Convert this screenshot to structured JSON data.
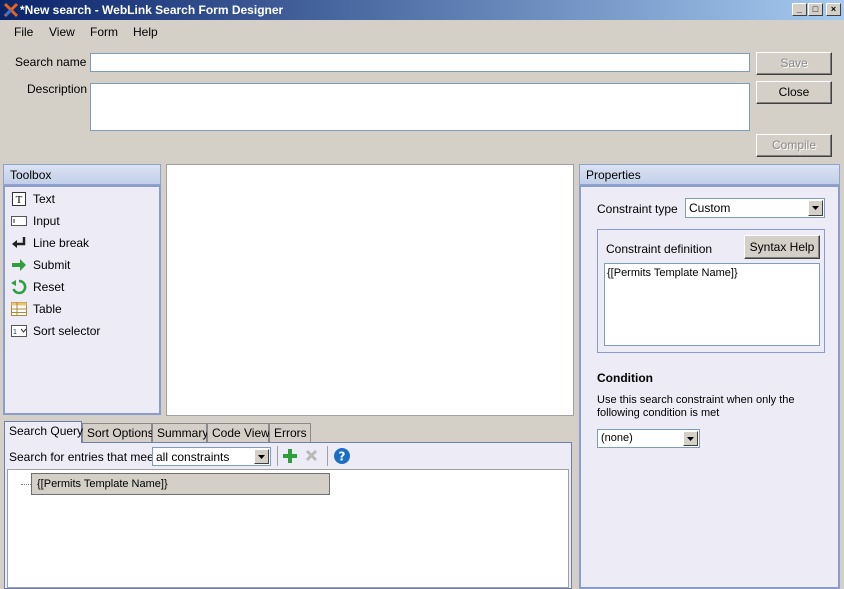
{
  "window": {
    "title": "*New search - WebLink Search Form Designer",
    "minimize": "_",
    "maximize": "□",
    "close": "×"
  },
  "menu": [
    "File",
    "View",
    "Form",
    "Help"
  ],
  "form": {
    "search_name_label": "Search name",
    "search_name_value": "",
    "description_label": "Description",
    "description_value": "",
    "save_label": "Save",
    "close_label": "Close",
    "compile_label": "Compile"
  },
  "toolbox": {
    "title": "Toolbox",
    "items": [
      {
        "label": "Text",
        "icon": "text-icon"
      },
      {
        "label": "Input",
        "icon": "input-icon"
      },
      {
        "label": "Line break",
        "icon": "line-break-icon"
      },
      {
        "label": "Submit",
        "icon": "submit-icon"
      },
      {
        "label": "Reset",
        "icon": "reset-icon"
      },
      {
        "label": "Table",
        "icon": "table-icon"
      },
      {
        "label": "Sort selector",
        "icon": "sort-selector-icon"
      }
    ]
  },
  "tabs": [
    "Search Query",
    "Sort Options",
    "Summary",
    "Code View",
    "Errors"
  ],
  "query": {
    "match_label": "Search for entries that meet",
    "match_value": "all constraints",
    "tree_node": "{[Permits Template Name]}"
  },
  "properties": {
    "title": "Properties",
    "constraint_type_label": "Constraint type",
    "constraint_type_value": "Custom",
    "constraint_definition_label": "Constraint definition",
    "syntax_help_label": "Syntax Help",
    "constraint_definition_value": "{[Permits Template Name]}",
    "condition_heading": "Condition",
    "condition_text": "Use this search constraint when only the following condition is met",
    "condition_value": "(none)"
  },
  "colors": {
    "titlebar_start": "#0a246a",
    "titlebar_end": "#a6caf0",
    "panel_body": "#ecebf6",
    "add_icon": "#2e9e3e",
    "help_icon": "#1a6fc4"
  }
}
